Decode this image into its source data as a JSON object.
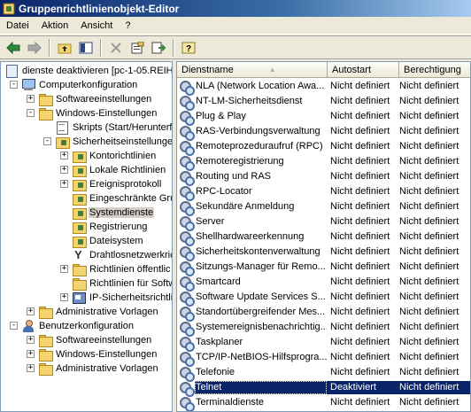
{
  "window": {
    "title": "Gruppenrichtlinienobjekt-Editor"
  },
  "menu": [
    "Datei",
    "Aktion",
    "Ansicht",
    "?"
  ],
  "toolbar": [
    "back-arrow-icon",
    "forward-arrow-icon",
    "up-folder-icon",
    "show-hide-tree-icon",
    "delete-icon",
    "properties-icon",
    "export-list-icon",
    "help-icon"
  ],
  "tree": [
    {
      "label": "dienste deaktivieren [pc-1-05.REIH",
      "level": 0,
      "icon": "policy-doc-icon",
      "expander": ""
    },
    {
      "label": "Computerkonfiguration",
      "level": 1,
      "icon": "computer-icon",
      "expander": "-"
    },
    {
      "label": "Softwareeinstellungen",
      "level": 2,
      "icon": "folder-icon",
      "expander": "+"
    },
    {
      "label": "Windows-Einstellungen",
      "level": 2,
      "icon": "folder-icon",
      "expander": "-"
    },
    {
      "label": "Skripts (Start/Herunterfah",
      "level": 3,
      "icon": "script-icon",
      "expander": ""
    },
    {
      "label": "Sicherheitseinstellungen",
      "level": 3,
      "icon": "security-icon",
      "expander": "-"
    },
    {
      "label": "Kontorichtlinien",
      "level": 4,
      "icon": "policy-folder-icon",
      "expander": "+"
    },
    {
      "label": "Lokale Richtlinien",
      "level": 4,
      "icon": "policy-folder-icon",
      "expander": "+"
    },
    {
      "label": "Ereignisprotokoll",
      "level": 4,
      "icon": "policy-folder-icon",
      "expander": "+"
    },
    {
      "label": "Eingeschränkte Grup",
      "level": 4,
      "icon": "policy-folder-icon",
      "expander": ""
    },
    {
      "label": "Systemdienste",
      "level": 4,
      "icon": "policy-folder-icon",
      "expander": "",
      "selected": true
    },
    {
      "label": "Registrierung",
      "level": 4,
      "icon": "policy-folder-icon",
      "expander": ""
    },
    {
      "label": "Dateisystem",
      "level": 4,
      "icon": "policy-folder-icon",
      "expander": ""
    },
    {
      "label": "Drahtlosnetzwerkric",
      "level": 4,
      "icon": "antenna-icon",
      "expander": ""
    },
    {
      "label": "Richtlinien öffentlic",
      "level": 4,
      "icon": "folder-icon",
      "expander": "+"
    },
    {
      "label": "Richtlinien für Softw",
      "level": 4,
      "icon": "folder-icon",
      "expander": ""
    },
    {
      "label": "IP-Sicherheitsrichtlin",
      "level": 4,
      "icon": "ipsec-icon",
      "expander": "+"
    },
    {
      "label": "Administrative Vorlagen",
      "level": 2,
      "icon": "folder-icon",
      "expander": "+"
    },
    {
      "label": "Benutzerkonfiguration",
      "level": 1,
      "icon": "user-icon",
      "expander": "-"
    },
    {
      "label": "Softwareeinstellungen",
      "level": 2,
      "icon": "folder-icon",
      "expander": "+"
    },
    {
      "label": "Windows-Einstellungen",
      "level": 2,
      "icon": "folder-icon",
      "expander": "+"
    },
    {
      "label": "Administrative Vorlagen",
      "level": 2,
      "icon": "folder-icon",
      "expander": "+"
    }
  ],
  "list": {
    "columns": [
      "Dienstname",
      "Autostart",
      "Berechtigung"
    ],
    "sort_indicator": "▲",
    "rows": [
      {
        "name": "NLA (Network Location Awa...",
        "start": "Nicht definiert",
        "perm": "Nicht definiert"
      },
      {
        "name": "NT-LM-Sicherheitsdienst",
        "start": "Nicht definiert",
        "perm": "Nicht definiert"
      },
      {
        "name": "Plug & Play",
        "start": "Nicht definiert",
        "perm": "Nicht definiert"
      },
      {
        "name": "RAS-Verbindungsverwaltung",
        "start": "Nicht definiert",
        "perm": "Nicht definiert"
      },
      {
        "name": "Remoteprozeduraufruf (RPC)",
        "start": "Nicht definiert",
        "perm": "Nicht definiert"
      },
      {
        "name": "Remoteregistrierung",
        "start": "Nicht definiert",
        "perm": "Nicht definiert"
      },
      {
        "name": "Routing und RAS",
        "start": "Nicht definiert",
        "perm": "Nicht definiert"
      },
      {
        "name": "RPC-Locator",
        "start": "Nicht definiert",
        "perm": "Nicht definiert"
      },
      {
        "name": "Sekundäre Anmeldung",
        "start": "Nicht definiert",
        "perm": "Nicht definiert"
      },
      {
        "name": "Server",
        "start": "Nicht definiert",
        "perm": "Nicht definiert"
      },
      {
        "name": "Shellhardwareerkennung",
        "start": "Nicht definiert",
        "perm": "Nicht definiert"
      },
      {
        "name": "Sicherheitskontenverwaltung",
        "start": "Nicht definiert",
        "perm": "Nicht definiert"
      },
      {
        "name": "Sitzungs-Manager für Remo...",
        "start": "Nicht definiert",
        "perm": "Nicht definiert"
      },
      {
        "name": "Smartcard",
        "start": "Nicht definiert",
        "perm": "Nicht definiert"
      },
      {
        "name": "Software Update Services S...",
        "start": "Nicht definiert",
        "perm": "Nicht definiert"
      },
      {
        "name": "Standortübergreifender Mes...",
        "start": "Nicht definiert",
        "perm": "Nicht definiert"
      },
      {
        "name": "Systemereignisbenachrichtig...",
        "start": "Nicht definiert",
        "perm": "Nicht definiert"
      },
      {
        "name": "Taskplaner",
        "start": "Nicht definiert",
        "perm": "Nicht definiert"
      },
      {
        "name": "TCP/IP-NetBIOS-Hilfsprogra...",
        "start": "Nicht definiert",
        "perm": "Nicht definiert"
      },
      {
        "name": "Telefonie",
        "start": "Nicht definiert",
        "perm": "Nicht definiert"
      },
      {
        "name": "Telnet",
        "start": "Deaktiviert",
        "perm": "Nicht definiert",
        "selected": true
      },
      {
        "name": "Terminaldienste",
        "start": "Nicht definiert",
        "perm": "Nicht definiert"
      }
    ]
  }
}
